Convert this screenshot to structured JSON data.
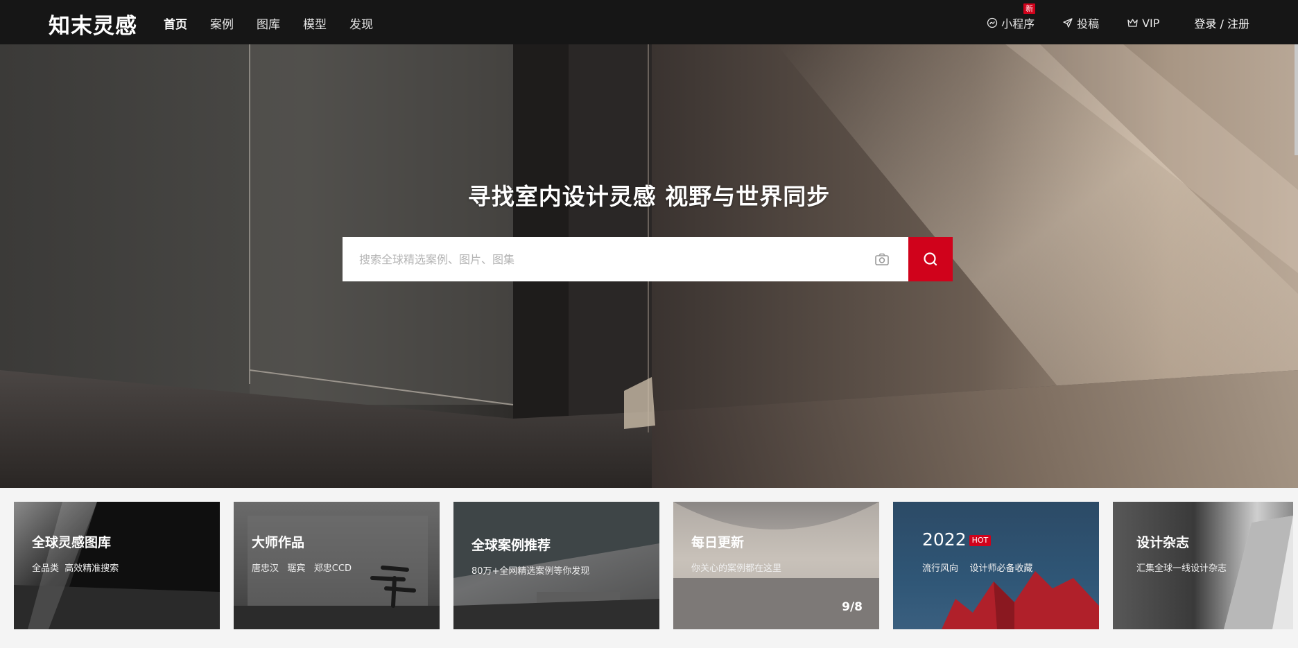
{
  "header": {
    "logo": "知末灵感",
    "nav": [
      "首页",
      "案例",
      "图库",
      "模型",
      "发现"
    ],
    "mini_program": "小程序",
    "new_badge": "新",
    "submit": "投稿",
    "vip": "VIP",
    "login": "登录 / 注册"
  },
  "hero": {
    "title": "寻找室内设计灵感 视野与世界同步",
    "search_placeholder": "搜索全球精选案例、图片、图集"
  },
  "cards": [
    {
      "title": "全球灵感图库",
      "subtitle": "全品类  高效精准搜索"
    },
    {
      "title": "大师作品",
      "subtitle": "唐忠汉   琚宾   郑忠CCD"
    },
    {
      "title": "全球案例推荐",
      "subtitle": "80万+全网精选案例等你发现"
    },
    {
      "title": "每日更新",
      "subtitle": "你关心的案例都在这里",
      "pager": "9/8"
    },
    {
      "title": "2022",
      "badge": "HOT",
      "subtitle": "流行风向    设计师必备收藏"
    },
    {
      "title": "设计杂志",
      "subtitle": "汇集全球一线设计杂志"
    }
  ],
  "colors": {
    "accent": "#d0021b",
    "topbar": "#161616"
  }
}
